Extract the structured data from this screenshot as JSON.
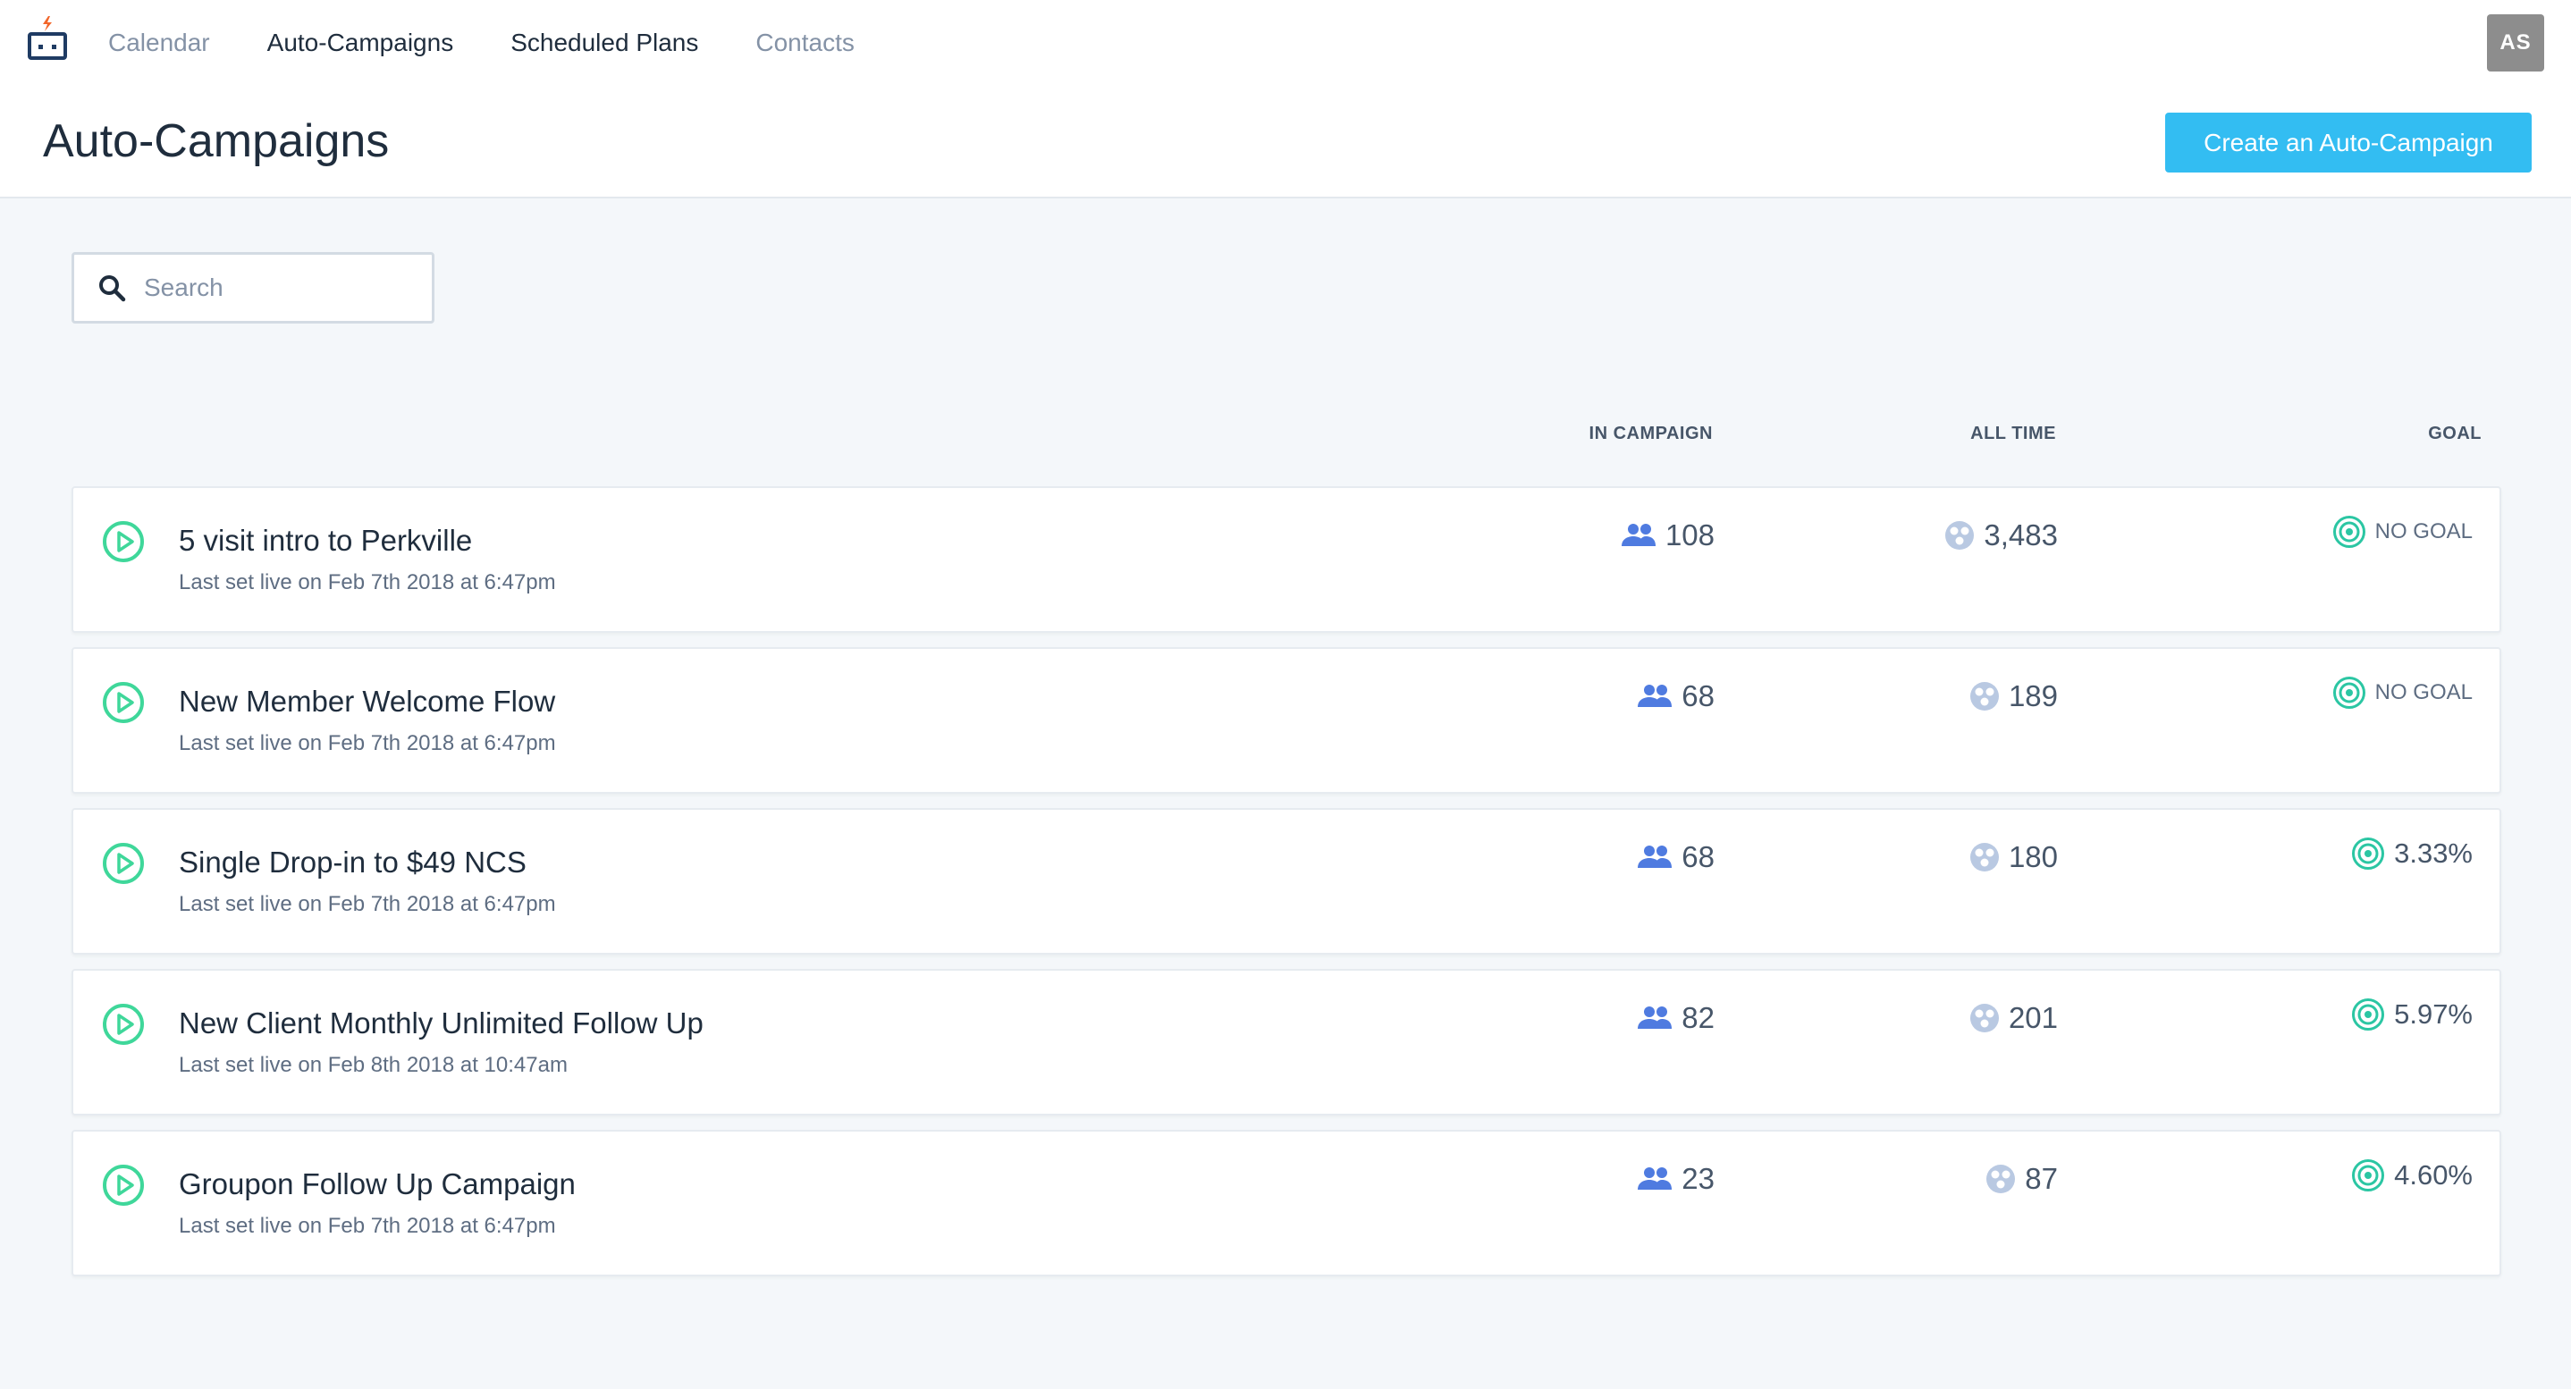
{
  "nav": {
    "items": [
      {
        "label": "Calendar",
        "active": false
      },
      {
        "label": "Auto-Campaigns",
        "active": true
      },
      {
        "label": "Scheduled Plans",
        "active": true
      },
      {
        "label": "Contacts",
        "active": false
      }
    ],
    "avatar_initials": "AS"
  },
  "page": {
    "title": "Auto-Campaigns",
    "create_button_label": "Create an Auto-Campaign"
  },
  "search": {
    "placeholder": "Search",
    "value": ""
  },
  "table": {
    "headers": {
      "in_campaign": "IN CAMPAIGN",
      "all_time": "ALL TIME",
      "goal": "GOAL"
    },
    "rows": [
      {
        "name": "5 visit intro to Perkville",
        "subtitle": "Last set live on Feb 7th 2018 at 6:47pm",
        "in_campaign": "108",
        "all_time": "3,483",
        "goal": "NO GOAL",
        "goal_type": "text"
      },
      {
        "name": "New Member Welcome Flow",
        "subtitle": "Last set live on Feb 7th 2018 at 6:47pm",
        "in_campaign": "68",
        "all_time": "189",
        "goal": "NO GOAL",
        "goal_type": "text"
      },
      {
        "name": "Single Drop-in to $49 NCS",
        "subtitle": "Last set live on Feb 7th 2018 at 6:47pm",
        "in_campaign": "68",
        "all_time": "180",
        "goal": "3.33%",
        "goal_type": "pct"
      },
      {
        "name": "New Client Monthly Unlimited Follow Up",
        "subtitle": "Last set live on Feb 8th 2018 at 10:47am",
        "in_campaign": "82",
        "all_time": "201",
        "goal": "5.97%",
        "goal_type": "pct"
      },
      {
        "name": "Groupon Follow Up Campaign",
        "subtitle": "Last set live on Feb 7th 2018 at 6:47pm",
        "in_campaign": "23",
        "all_time": "87",
        "goal": "4.60%",
        "goal_type": "pct"
      }
    ]
  },
  "icons": {
    "logo": "briefcase-lightning-icon",
    "search": "search-icon",
    "row_status": "play-circle-icon",
    "in_campaign": "people-icon",
    "all_time": "dots-circle-icon",
    "goal": "target-icon"
  },
  "colors": {
    "accent": "#33bdf2",
    "play_green": "#3fd79a",
    "people_blue": "#4f7be0",
    "target_teal": "#2bc6a3",
    "logo_orange": "#f2662a",
    "logo_navy": "#1f3b63"
  }
}
